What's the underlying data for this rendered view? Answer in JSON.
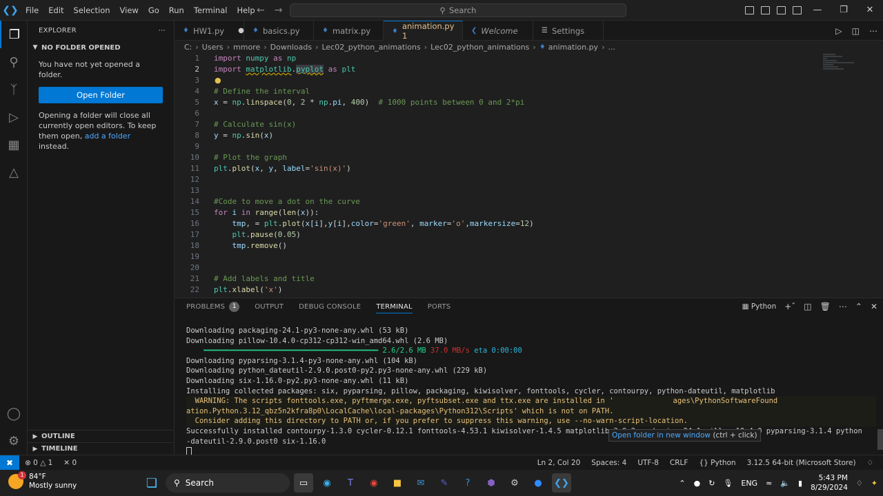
{
  "titlebar": {
    "menu": [
      "File",
      "Edit",
      "Selection",
      "View",
      "Go",
      "Run",
      "Terminal",
      "Help"
    ],
    "search_placeholder": "Search"
  },
  "sidebar": {
    "title": "EXPLORER",
    "section": "NO FOLDER OPENED",
    "message": "You have not yet opened a folder.",
    "open_button": "Open Folder",
    "note_1": "Opening a folder will close all currently open editors. To keep them open, ",
    "note_link": "add a folder",
    "note_2": " instead.",
    "outline": "OUTLINE",
    "timeline": "TIMELINE"
  },
  "tabs": [
    {
      "name": "HW1.py",
      "state": "modified"
    },
    {
      "name": "basics.py",
      "state": ""
    },
    {
      "name": "matrix.py",
      "state": ""
    },
    {
      "name": "animation.py 1",
      "state": "active"
    },
    {
      "name": "Welcome",
      "state": "italic"
    },
    {
      "name": "Settings",
      "state": ""
    }
  ],
  "breadcrumb": [
    "C:",
    "Users",
    "mmore",
    "Downloads",
    "Lec02_python_animations",
    "Lec02_python_animations",
    "animation.py",
    "..."
  ],
  "code_lines": [
    "1",
    "2",
    "3",
    "4",
    "5",
    "6",
    "7",
    "8",
    "9",
    "10",
    "11",
    "12",
    "13",
    "14",
    "15",
    "16",
    "17",
    "18",
    "19",
    "20",
    "21",
    "22"
  ],
  "panel": {
    "tabs": [
      "PROBLEMS",
      "OUTPUT",
      "DEBUG CONSOLE",
      "TERMINAL",
      "PORTS"
    ],
    "problems_count": "1",
    "profile": "Python",
    "terminal_lines": [
      "Downloading packaging-24.1-py3-none-any.whl (53 kB)",
      "Downloading pillow-10.4.0-cp312-cp312-win_amd64.whl (2.6 MB)",
      "",
      "Downloading pyparsing-3.1.4-py3-none-any.whl (104 kB)",
      "Downloading python_dateutil-2.9.0.post0-py2.py3-none-any.whl (229 kB)",
      "Downloading six-1.16.0-py2.py3-none-any.whl (11 kB)",
      "Installing collected packages: six, pyparsing, pillow, packaging, kiwisolver, fonttools, cycler, contourpy, python-dateutil, matplotlib",
      "  WARNING: The scripts fonttools.exe, pyftmerge.exe, pyftsubset.exe and ttx.exe are installed in '",
      "ation.Python.3.12_qbz5n2kfra8p0\\LocalCache\\local-packages\\Python312\\Scripts' which is not on PATH.",
      "  Consider adding this directory to PATH or, if you prefer to suppress this warning, use --no-warn-script-location.",
      "Successfully installed contourpy-1.3.0 cycler-0.12.1 fonttools-4.53.1 kiwisolver-1.4.5 matplotlib-3.9.2 packaging-24.1 pillow-10.4.0 pyparsing-3.1.4 python",
      "-dateutil-2.9.0.post0 six-1.16.0"
    ],
    "progress_text": "2.6/2.6 MB",
    "progress_speed": "37.0 MB/s",
    "progress_eta": "eta 0:00:00",
    "warning_tail": "ages\\PythonSoftwareFound",
    "tooltip_link": "Open folder in new window",
    "tooltip_hint": " (ctrl + click)"
  },
  "statusbar": {
    "errors": "0",
    "warnings": "1",
    "ports": "0",
    "position": "Ln 2, Col 20",
    "spaces": "Spaces: 4",
    "encoding": "UTF-8",
    "eol": "CRLF",
    "language": "Python",
    "interpreter": "3.12.5 64-bit (Microsoft Store)"
  },
  "taskbar": {
    "temp": "84°F",
    "weather": "Mostly sunny",
    "weather_badge": "1",
    "search": "Search",
    "lang": "ENG",
    "time": "5:43 PM",
    "date": "8/29/2024"
  }
}
